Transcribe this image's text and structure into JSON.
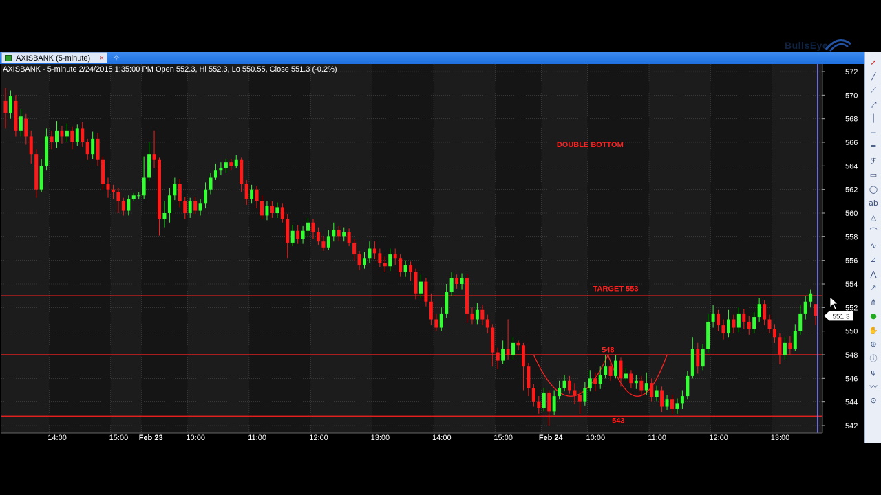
{
  "window": {
    "tab_label": "AXISBANK (5-minute)",
    "tab_close": "×",
    "new_tab": "✧",
    "brand": "BullsEye"
  },
  "toolbar": {
    "tools": [
      "cursor-icon",
      "line-icon",
      "ray-icon",
      "extended-line-icon",
      "vertical-line-icon",
      "horizontal-line-icon",
      "channel-icon",
      "fibonacci-icon",
      "rectangle-icon",
      "ellipse-icon",
      "text-icon",
      "triangle-icon",
      "arc-icon",
      "curve-icon",
      "gann-icon",
      "zigzag-icon",
      "arrow-icon",
      "andrews-icon",
      "globe-icon",
      "pan-icon",
      "zoom-icon",
      "info-icon",
      "pitchfork-icon",
      "wave-icon",
      "magnet-icon"
    ]
  },
  "colors": {
    "background": "#1c1c1c",
    "band_dark": "#111111",
    "bull": "#33ff33",
    "bear": "#ff1a1a",
    "annotation": "#ff2020",
    "axis_text": "#ffffff",
    "grid": "#4a4a4a",
    "cursor_line": "#8080ff"
  },
  "chart_data": {
    "type": "candlestick",
    "title": "AXISBANK - 5-minute 2/24/2015 1:35:00 PM Open 552.3, Hi 552.3, Lo 550.55, Close 551.3 (-0.2%)",
    "symbol": "AXISBANK",
    "interval": "5-minute",
    "last_price_label": "551.3",
    "ylim": [
      541.5,
      572.8
    ],
    "yticks": [
      542,
      544,
      546,
      548,
      550,
      552,
      554,
      556,
      558,
      560,
      562,
      564,
      566,
      568,
      570,
      572
    ],
    "xticks": [
      {
        "label": "14:00",
        "bar": 9,
        "bold": false
      },
      {
        "label": "15:00",
        "bar": 21,
        "bold": false
      },
      {
        "label": "Feb 23",
        "bar": 27,
        "bold": true
      },
      {
        "label": "10:00",
        "bar": 36,
        "bold": false
      },
      {
        "label": "11:00",
        "bar": 48,
        "bold": false
      },
      {
        "label": "12:00",
        "bar": 60,
        "bold": false
      },
      {
        "label": "13:00",
        "bar": 72,
        "bold": false
      },
      {
        "label": "14:00",
        "bar": 84,
        "bold": false
      },
      {
        "label": "15:00",
        "bar": 96,
        "bold": false
      },
      {
        "label": "Feb 24",
        "bar": 105,
        "bold": true
      },
      {
        "label": "10:00",
        "bar": 114,
        "bold": false
      },
      {
        "label": "11:00",
        "bar": 126,
        "bold": false
      },
      {
        "label": "12:00",
        "bar": 138,
        "bold": false
      },
      {
        "label": "13:00",
        "bar": 150,
        "bold": false
      }
    ],
    "horizontal_lines": [
      553.0,
      548.0,
      542.8
    ],
    "annotations": [
      {
        "text": "DOUBLE  BOTTOM",
        "x": 114,
        "y": 565.6
      },
      {
        "text": "TARGET 553",
        "x": 119,
        "y": 553.4
      },
      {
        "text": "548",
        "x": 117.5,
        "y": 548.2
      },
      {
        "text": "543",
        "x": 119.5,
        "y": 542.2
      }
    ],
    "arcs": [
      {
        "x_from": 103,
        "x_to": 117.5,
        "y_top": 548.0,
        "y_bottom": 542.8
      },
      {
        "x_from": 117.5,
        "x_to": 129,
        "y_top": 548.0,
        "y_bottom": 542.8
      }
    ],
    "candles": [
      [
        569.5,
        568.5,
        570.6,
        567.2
      ],
      [
        568.5,
        569.9,
        570.4,
        568.0
      ],
      [
        569.5,
        567.0,
        570.0,
        566.5
      ],
      [
        567.0,
        568.2,
        568.8,
        566.5
      ],
      [
        568.0,
        566.5,
        568.4,
        565.8
      ],
      [
        566.5,
        565.0,
        567.0,
        564.2
      ],
      [
        565.0,
        562.0,
        565.4,
        561.3
      ],
      [
        562.0,
        564.0,
        564.6,
        561.8
      ],
      [
        564.0,
        566.5,
        567.2,
        563.6
      ],
      [
        566.5,
        566.0,
        567.0,
        565.4
      ],
      [
        566.0,
        567.0,
        567.8,
        565.5
      ],
      [
        567.0,
        566.5,
        567.4,
        565.9
      ],
      [
        566.5,
        567.0,
        567.6,
        566.0
      ],
      [
        567.0,
        566.0,
        567.3,
        565.4
      ],
      [
        566.0,
        567.2,
        567.5,
        565.7
      ],
      [
        567.2,
        566.0,
        567.7,
        565.6
      ],
      [
        566.0,
        565.0,
        566.3,
        564.5
      ],
      [
        565.0,
        566.3,
        566.9,
        564.6
      ],
      [
        566.3,
        564.5,
        566.8,
        564.0
      ],
      [
        564.5,
        562.5,
        564.8,
        562.0
      ],
      [
        562.5,
        562.0,
        563.0,
        561.3
      ],
      [
        562.0,
        561.8,
        562.4,
        561.2
      ],
      [
        561.8,
        561.0,
        562.1,
        560.0
      ],
      [
        561.0,
        560.2,
        561.3,
        559.8
      ],
      [
        560.2,
        561.2,
        561.5,
        559.8
      ],
      [
        561.2,
        561.5,
        561.7,
        561.0
      ],
      [
        561.5,
        561.5,
        561.8,
        561.2
      ],
      [
        561.5,
        563.0,
        564.8,
        561.2
      ],
      [
        563.0,
        565.0,
        566.0,
        562.7
      ],
      [
        565.0,
        564.5,
        567.0,
        563.8
      ],
      [
        564.5,
        559.5,
        564.7,
        558.1
      ],
      [
        559.5,
        560.0,
        561.0,
        558.8
      ],
      [
        560.0,
        561.5,
        562.1,
        559.2
      ],
      [
        561.5,
        562.5,
        563.0,
        561.1
      ],
      [
        562.5,
        561.0,
        562.9,
        560.5
      ],
      [
        561.0,
        560.0,
        561.4,
        559.5
      ],
      [
        560.0,
        561.0,
        561.3,
        559.6
      ],
      [
        561.0,
        560.2,
        561.4,
        559.9
      ],
      [
        560.2,
        560.8,
        561.2,
        559.8
      ],
      [
        560.8,
        562.0,
        562.6,
        560.4
      ],
      [
        562.0,
        563.0,
        563.4,
        561.6
      ],
      [
        563.0,
        563.6,
        564.2,
        562.8
      ],
      [
        563.6,
        563.8,
        564.3,
        563.2
      ],
      [
        563.8,
        564.3,
        564.6,
        563.4
      ],
      [
        564.3,
        564.0,
        564.6,
        563.6
      ],
      [
        564.0,
        564.5,
        564.9,
        563.8
      ],
      [
        564.5,
        562.5,
        564.7,
        561.8
      ],
      [
        562.5,
        561.2,
        562.8,
        560.7
      ],
      [
        561.2,
        562.0,
        562.4,
        560.8
      ],
      [
        562.0,
        561.0,
        562.3,
        560.4
      ],
      [
        561.0,
        559.8,
        561.5,
        559.5
      ],
      [
        559.8,
        560.6,
        561.0,
        559.4
      ],
      [
        560.6,
        560.0,
        561.0,
        559.6
      ],
      [
        560.0,
        560.5,
        560.9,
        559.6
      ],
      [
        560.5,
        559.5,
        560.8,
        559.2
      ],
      [
        559.5,
        557.5,
        559.9,
        556.2
      ],
      [
        557.5,
        558.5,
        559.0,
        557.2
      ],
      [
        558.5,
        557.8,
        559.0,
        557.4
      ],
      [
        557.8,
        558.5,
        558.9,
        557.4
      ],
      [
        558.5,
        559.2,
        559.6,
        558.0
      ],
      [
        559.2,
        558.4,
        559.5,
        557.8
      ],
      [
        558.4,
        557.6,
        558.8,
        557.3
      ],
      [
        557.6,
        557.1,
        558.0,
        556.8
      ],
      [
        557.1,
        558.0,
        558.6,
        556.9
      ],
      [
        558.0,
        558.6,
        559.2,
        557.6
      ],
      [
        558.6,
        558.0,
        558.9,
        557.6
      ],
      [
        558.0,
        558.4,
        558.8,
        557.6
      ],
      [
        558.4,
        557.5,
        558.7,
        557.2
      ],
      [
        557.5,
        556.5,
        557.8,
        556.0
      ],
      [
        556.5,
        555.6,
        556.8,
        555.2
      ],
      [
        555.6,
        556.2,
        556.7,
        555.3
      ],
      [
        556.2,
        557.0,
        557.6,
        555.8
      ],
      [
        557.0,
        556.6,
        557.6,
        556.1
      ],
      [
        556.6,
        555.8,
        557.0,
        555.4
      ],
      [
        555.8,
        555.5,
        556.3,
        555.0
      ],
      [
        555.5,
        556.5,
        557.0,
        555.1
      ],
      [
        556.5,
        556.2,
        557.0,
        555.6
      ],
      [
        556.2,
        555.0,
        556.5,
        554.6
      ],
      [
        555.0,
        555.6,
        556.0,
        554.6
      ],
      [
        555.6,
        555.0,
        555.9,
        554.3
      ],
      [
        555.0,
        553.2,
        555.3,
        552.7
      ],
      [
        553.2,
        554.2,
        554.8,
        552.8
      ],
      [
        554.2,
        552.5,
        554.5,
        552.1
      ],
      [
        552.5,
        551.0,
        553.2,
        550.5
      ],
      [
        551.0,
        550.3,
        551.5,
        550.0
      ],
      [
        550.3,
        551.5,
        552.0,
        550.0
      ],
      [
        551.5,
        553.3,
        554.0,
        551.1
      ],
      [
        553.3,
        554.5,
        555.0,
        553.0
      ],
      [
        554.5,
        554.0,
        554.8,
        553.6
      ],
      [
        554.0,
        554.5,
        554.9,
        553.5
      ],
      [
        554.5,
        551.5,
        554.8,
        550.7
      ],
      [
        551.5,
        551.0,
        552.0,
        550.6
      ],
      [
        551.0,
        551.8,
        552.4,
        550.6
      ],
      [
        551.8,
        551.0,
        552.2,
        550.5
      ],
      [
        551.0,
        550.3,
        551.4,
        549.8
      ],
      [
        550.3,
        548.2,
        550.6,
        547.0
      ],
      [
        548.2,
        547.5,
        548.6,
        546.8
      ],
      [
        547.5,
        548.5,
        549.2,
        547.2
      ],
      [
        548.5,
        548.0,
        551.0,
        547.6
      ],
      [
        548.0,
        549.0,
        549.5,
        547.6
      ],
      [
        549.0,
        548.8,
        549.2,
        548.4
      ],
      [
        548.8,
        547.0,
        549.0,
        545.0
      ],
      [
        547.0,
        545.2,
        547.3,
        544.5
      ],
      [
        545.2,
        544.0,
        545.5,
        543.6
      ],
      [
        544.0,
        543.5,
        544.5,
        543.0
      ],
      [
        543.5,
        544.8,
        545.2,
        543.2
      ],
      [
        544.8,
        543.2,
        545.0,
        542.0
      ],
      [
        543.2,
        544.5,
        545.0,
        542.9
      ],
      [
        544.5,
        545.2,
        545.8,
        544.2
      ],
      [
        545.2,
        545.8,
        546.3,
        544.9
      ],
      [
        545.8,
        545.0,
        546.2,
        544.7
      ],
      [
        545.0,
        544.6,
        545.6,
        543.8
      ],
      [
        544.6,
        544.0,
        545.0,
        543.0
      ],
      [
        544.0,
        545.2,
        545.7,
        543.7
      ],
      [
        545.2,
        546.0,
        546.7,
        544.9
      ],
      [
        546.0,
        545.5,
        546.5,
        544.9
      ],
      [
        545.5,
        546.3,
        547.0,
        545.1
      ],
      [
        546.3,
        547.0,
        548.0,
        546.0
      ],
      [
        547.0,
        546.2,
        547.4,
        545.8
      ],
      [
        546.2,
        547.5,
        548.0,
        546.0
      ],
      [
        547.5,
        546.0,
        547.8,
        545.3
      ],
      [
        546.0,
        546.4,
        546.9,
        545.8
      ],
      [
        546.4,
        545.6,
        546.7,
        545.2
      ],
      [
        545.6,
        545.8,
        546.3,
        545.1
      ],
      [
        545.8,
        545.0,
        546.2,
        544.5
      ],
      [
        545.0,
        545.6,
        546.5,
        544.6
      ],
      [
        545.6,
        544.4,
        546.0,
        544.0
      ],
      [
        544.4,
        545.0,
        545.4,
        544.1
      ],
      [
        545.0,
        543.6,
        545.3,
        543.1
      ],
      [
        543.6,
        544.2,
        544.6,
        543.3
      ],
      [
        544.2,
        543.4,
        544.6,
        543.0
      ],
      [
        543.4,
        543.9,
        544.3,
        543.0
      ],
      [
        543.9,
        544.5,
        545.0,
        543.4
      ],
      [
        544.5,
        546.2,
        546.6,
        544.2
      ],
      [
        546.2,
        548.5,
        549.5,
        546.0
      ],
      [
        548.5,
        547.0,
        549.0,
        546.4
      ],
      [
        547.0,
        548.5,
        548.9,
        546.7
      ],
      [
        548.5,
        550.8,
        551.5,
        548.2
      ],
      [
        550.8,
        551.5,
        552.2,
        550.3
      ],
      [
        551.5,
        550.5,
        551.8,
        550.0
      ],
      [
        550.5,
        549.8,
        551.0,
        549.3
      ],
      [
        549.8,
        551.0,
        551.8,
        549.5
      ],
      [
        551.0,
        550.3,
        551.4,
        549.8
      ],
      [
        550.3,
        551.5,
        552.0,
        549.9
      ],
      [
        551.5,
        550.8,
        551.9,
        550.2
      ],
      [
        550.8,
        550.2,
        551.3,
        549.7
      ],
      [
        550.2,
        551.2,
        551.6,
        549.8
      ],
      [
        551.2,
        552.3,
        552.8,
        550.8
      ],
      [
        552.3,
        551.0,
        552.6,
        550.5
      ],
      [
        551.0,
        550.2,
        551.4,
        549.8
      ],
      [
        550.2,
        549.5,
        550.6,
        549.0
      ],
      [
        549.5,
        548.0,
        549.8,
        547.2
      ],
      [
        548.0,
        549.0,
        549.5,
        547.6
      ],
      [
        549.0,
        548.5,
        549.6,
        548.0
      ],
      [
        548.5,
        550.0,
        550.6,
        548.3
      ],
      [
        550.0,
        551.5,
        552.2,
        549.7
      ],
      [
        551.5,
        552.5,
        553.0,
        551.0
      ],
      [
        552.5,
        553.2,
        553.5,
        552.0
      ],
      [
        552.3,
        551.3,
        552.3,
        550.55
      ]
    ]
  }
}
